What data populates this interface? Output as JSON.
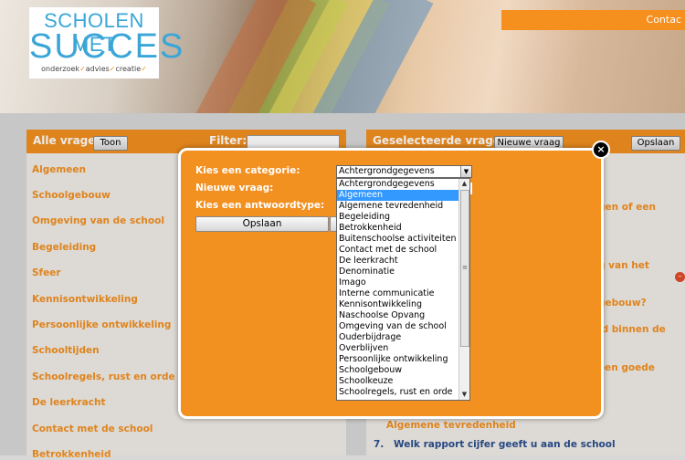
{
  "header": {
    "logo_line1": "SCHOLEN MET",
    "logo_line2": "SUCCES",
    "logo_tagline_1": "onderzoek",
    "logo_tagline_2": "advies",
    "logo_tagline_3": "creatie",
    "contact": "Contac"
  },
  "left_panel": {
    "title": "Alle vragen",
    "show_button": "Toon",
    "filter_label": "Filter:",
    "categories": [
      "Algemeen",
      "Schoolgebouw",
      "Omgeving van de school",
      "Begeleiding",
      "Sfeer",
      "Kennisontwikkeling",
      "Persoonlijke ontwikkeling",
      "Schooltijden",
      "Schoolregels, rust en orde",
      "De leerkracht",
      "Contact met de school",
      "Betrokkenheid"
    ]
  },
  "right_panel": {
    "title": "Geselecteerde vragen",
    "new_question_button": "Nieuwe vraag",
    "save_button": "Opslaan",
    "fragments": [
      "gen of een",
      "g van het",
      "gebouw?",
      "id binnen de",
      "een goede"
    ],
    "category_heading": "Algemene tevredenheid",
    "question_number": "7.",
    "question_text": "Welk rapport cijfer geeft u aan de school"
  },
  "modal": {
    "category_label": "Kies een categorie:",
    "new_question_label": "Nieuwe vraag:",
    "answer_type_label": "Kies een antwoordtype:",
    "save_button": "Opslaan",
    "selected_category": "Achtergrondgegevens",
    "options": [
      "Achtergrondgegevens",
      "Algemeen",
      "Algemene tevredenheid",
      "Begeleiding",
      "Betrokkenheid",
      "Buitenschoolse activiteiten",
      "Contact met de school",
      "De leerkracht",
      "Denominatie",
      "Imago",
      "Interne communicatie",
      "Kennisontwikkeling",
      "Naschoolse Opvang",
      "Omgeving van de school",
      "Ouderbijdrage",
      "Overblijven",
      "Persoonlijke ontwikkeling",
      "Schoolgebouw",
      "Schoolkeuze",
      "Schoolregels, rust en orde"
    ],
    "highlighted_option": "Algemeen",
    "close_symbol": "×"
  },
  "colors": {
    "accent": "#f29020",
    "logo_blue": "#3aa6d8",
    "link_blue": "#2a4f8f",
    "selection": "#3399ff"
  }
}
